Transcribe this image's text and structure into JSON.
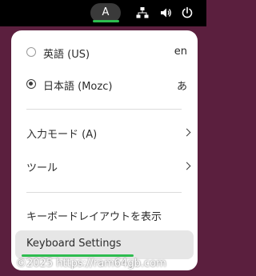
{
  "topbar": {
    "input_indicator": "A",
    "icons": [
      "network-icon",
      "volume-icon",
      "power-icon"
    ]
  },
  "menu": {
    "input_methods": [
      {
        "label": "英語 (US)",
        "shortcut": "en",
        "selected": false
      },
      {
        "label": "日本語 (Mozc)",
        "shortcut": "あ",
        "selected": true
      }
    ],
    "submenus": [
      {
        "label": "入力モード (A)"
      },
      {
        "label": "ツール"
      }
    ],
    "show_keyboard_layout": "キーボードレイアウトを表示",
    "keyboard_settings": "Keyboard Settings"
  },
  "watermark": "©2025 https://ram64gb.com",
  "colors": {
    "accent": "#2ebc4f",
    "desktop": "#5b1f3e",
    "menu_bg": "#ffffff",
    "highlight": "#e6e6e6"
  }
}
